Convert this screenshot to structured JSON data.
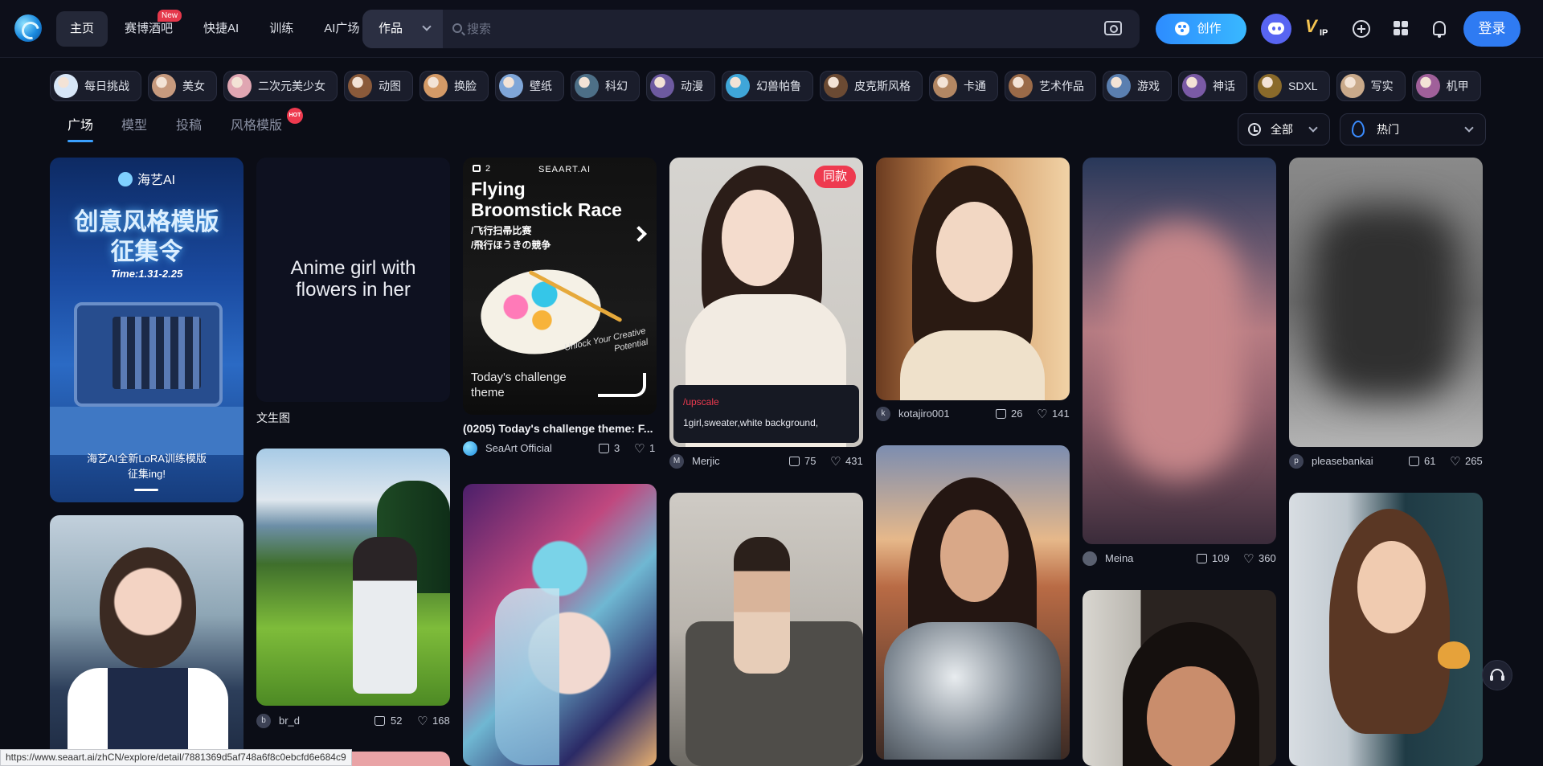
{
  "nav": {
    "items": [
      {
        "label": "主页",
        "active": true
      },
      {
        "label": "赛博酒吧",
        "badge": "New"
      },
      {
        "label": "快捷AI"
      },
      {
        "label": "训练"
      },
      {
        "label": "AI广场"
      }
    ]
  },
  "search": {
    "type": "作品",
    "placeholder": "搜索"
  },
  "header": {
    "create_label": "创作",
    "login_label": "登录",
    "vip_label": "V",
    "vip_sub": "IP"
  },
  "tags": [
    "每日挑战",
    "美女",
    "二次元美少女",
    "动图",
    "换脸",
    "壁纸",
    "科幻",
    "动漫",
    "幻兽帕鲁",
    "皮克斯风格",
    "卡通",
    "艺术作品",
    "游戏",
    "神话",
    "SDXL",
    "写实",
    "机甲"
  ],
  "tabs": [
    {
      "label": "广场",
      "active": true
    },
    {
      "label": "模型"
    },
    {
      "label": "投稿"
    },
    {
      "label": "风格模版",
      "badge": "HOT"
    }
  ],
  "filters": {
    "time": "全部",
    "sort": "热门"
  },
  "banner": {
    "brand": "海艺AI",
    "title1": "创意风格模版",
    "title2": "征集令",
    "time": "Time:1.31-2.25",
    "footer1": "海艺AI全新LoRA训练模版",
    "footer2": "征集ing!"
  },
  "cards": {
    "text_card": {
      "prompt": "Anime girl with flowers in her",
      "label": "文生图"
    },
    "challenge": {
      "count": "2",
      "brand": "SEAART.AI",
      "title": "Flying Broomstick Race",
      "sub1": "/飞行扫帚比赛",
      "sub2": "/飛行ほうきの競争",
      "script": "Unlock Your Creative Potential",
      "theme": "Today's challenge theme",
      "caption": "(0205) Today's challenge theme: F...",
      "author": "SeaArt Official",
      "likes": "3",
      "favs": "1"
    },
    "merjic": {
      "badge": "同款",
      "tooltip_label": "/upscale",
      "tooltip_prompt": "1girl,sweater,white background,",
      "avatar": "M",
      "author": "Merjic",
      "likes": "75",
      "favs": "431"
    },
    "kotajiro": {
      "avatar": "k",
      "author": "kotajiro001",
      "likes": "26",
      "favs": "141"
    },
    "meina": {
      "author": "Meina",
      "likes": "109",
      "favs": "360"
    },
    "pleasebankai": {
      "avatar": "p",
      "author": "pleasebankai",
      "likes": "61",
      "favs": "265"
    },
    "br_d": {
      "avatar": "b",
      "author": "br_d",
      "likes": "52",
      "favs": "168"
    }
  },
  "status_url": "https://www.seaart.ai/zhCN/explore/detail/7881369d5af748a6f8c0ebcfd6e684c9",
  "colors": {
    "background": "#0b0d16",
    "accent": "#2f7bf2",
    "hot": "#ee3a4f"
  }
}
